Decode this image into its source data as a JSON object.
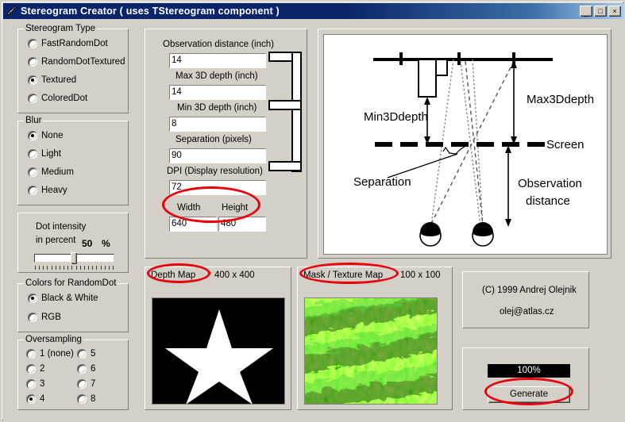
{
  "window": {
    "title": "Stereogram Creator ( uses TStereogram component )",
    "icon": "rocket-icon",
    "buttons": {
      "minimize": "_",
      "maximize": "□",
      "close": "×"
    },
    "titlebar_color": "#0a246a",
    "face_color": "#d4d0c8"
  },
  "stereogram_type": {
    "caption": "Stereogram Type",
    "options": [
      {
        "label": "FastRandomDot",
        "checked": false
      },
      {
        "label": "RandomDotTextured",
        "checked": false
      },
      {
        "label": "Textured",
        "checked": true
      },
      {
        "label": "ColoredDot",
        "checked": false
      }
    ]
  },
  "blur": {
    "caption": "Blur",
    "options": [
      {
        "label": "None",
        "checked": true
      },
      {
        "label": "Light",
        "checked": false
      },
      {
        "label": "Medium",
        "checked": false
      },
      {
        "label": "Heavy",
        "checked": false
      }
    ]
  },
  "dot_intensity": {
    "line1": "Dot intensity",
    "line2": "in percent",
    "value": "50",
    "unit": "%",
    "slider_position_percent": 50
  },
  "colors": {
    "caption": "Colors for RandomDot",
    "options": [
      {
        "label": "Black & White",
        "checked": true
      },
      {
        "label": "RGB",
        "checked": false
      }
    ]
  },
  "oversampling": {
    "caption": "Oversampling",
    "left_column": [
      {
        "label": "1 (none)",
        "checked": false
      },
      {
        "label": "2",
        "checked": false
      },
      {
        "label": "3",
        "checked": false
      },
      {
        "label": "4",
        "checked": true
      }
    ],
    "right_column": [
      {
        "label": "5",
        "checked": false
      },
      {
        "label": "6",
        "checked": false
      },
      {
        "label": "7",
        "checked": false
      },
      {
        "label": "8",
        "checked": false
      }
    ]
  },
  "parameters": {
    "fields": [
      {
        "label": "Observation distance (inch)",
        "value": "14"
      },
      {
        "label": "Max 3D depth (inch)",
        "value": "14"
      },
      {
        "label": "Min 3D depth (inch)",
        "value": "8"
      },
      {
        "label": "Separation (pixels)",
        "value": "90"
      },
      {
        "label": "DPI (Display resolution)",
        "value": "72"
      }
    ],
    "width": {
      "label": "Width",
      "value": "640"
    },
    "height": {
      "label": "Height",
      "value": "480"
    }
  },
  "diagram": {
    "labels": {
      "max_depth": "Max3Ddepth",
      "min_depth": "Min3Ddepth",
      "screen": "Screen",
      "separation": "Separation",
      "observation_line1": "Observation",
      "observation_line2": "distance"
    }
  },
  "depth_map": {
    "title": "Depth Map",
    "size": "400 x 400"
  },
  "texture_map": {
    "title": "Mask / Texture Map",
    "size": "100 x 100"
  },
  "credits": {
    "line1": "(C) 1999    Andrej Olejnik",
    "line2": "olej@atlas.cz"
  },
  "generate": {
    "progress_label": "100%",
    "progress_percent": 100,
    "button_label": "Generate"
  },
  "annotations": {
    "accent_color": "#e8000d",
    "circled": [
      "width-height-fields",
      "depth-map-title",
      "mask-texture-map-title",
      "generate-button"
    ]
  }
}
